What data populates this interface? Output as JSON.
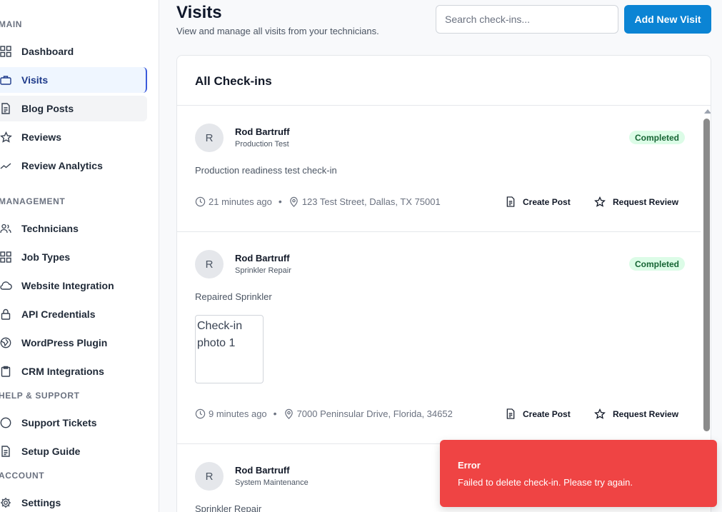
{
  "sidebar": {
    "sections": [
      {
        "label": "MAIN"
      },
      {
        "label": "MANAGEMENT"
      },
      {
        "label": "HELP & SUPPORT"
      },
      {
        "label": "ACCOUNT"
      }
    ],
    "items": [
      {
        "label": "Dashboard",
        "icon": "grid-icon"
      },
      {
        "label": "Visits",
        "icon": "briefcase-icon"
      },
      {
        "label": "Blog Posts",
        "icon": "document-icon"
      },
      {
        "label": "Reviews",
        "icon": "star-icon"
      },
      {
        "label": "Review Analytics",
        "icon": "trend-icon"
      },
      {
        "label": "Technicians",
        "icon": "users-icon"
      },
      {
        "label": "Job Types",
        "icon": "grid-icon"
      },
      {
        "label": "Website Integration",
        "icon": "cloud-icon"
      },
      {
        "label": "API Credentials",
        "icon": "lock-icon"
      },
      {
        "label": "WordPress Plugin",
        "icon": "globe-icon"
      },
      {
        "label": "CRM Integrations",
        "icon": "clipboard-icon"
      },
      {
        "label": "Support Tickets",
        "icon": "circle-icon"
      },
      {
        "label": "Setup Guide",
        "icon": "document-icon"
      },
      {
        "label": "Settings",
        "icon": "gear-icon"
      }
    ]
  },
  "header": {
    "title": "Visits",
    "subtitle": "View and manage all visits from your technicians.",
    "search_placeholder": "Search check-ins...",
    "add_button": "Add New Visit"
  },
  "card": {
    "title": "All Check-ins",
    "entries": [
      {
        "initial": "R",
        "name": "Rod Bartruff",
        "job": "Production Test",
        "status": "Completed",
        "description": "Production readiness test check-in",
        "time": "21 minutes ago",
        "location": "123 Test Street, Dallas, TX 75001",
        "create_post": "Create Post",
        "request_review": "Request Review"
      },
      {
        "initial": "R",
        "name": "Rod Bartruff",
        "job": "Sprinkler Repair",
        "status": "Completed",
        "description": "Repaired Sprinkler",
        "photo_alt": "Check-in photo 1",
        "time": "9 minutes ago",
        "location": "7000 Peninsular Drive, Florida, 34652",
        "create_post": "Create Post",
        "request_review": "Request Review"
      },
      {
        "initial": "R",
        "name": "Rod Bartruff",
        "job": "System Maintenance",
        "description": "Sprinkler Repair"
      }
    ]
  },
  "toast": {
    "title": "Error",
    "message": "Failed to delete check-in. Please try again."
  },
  "colors": {
    "primary": "#0b84d4",
    "badge_bg": "#dcfce7",
    "badge_text": "#166534",
    "error": "#ef4444"
  }
}
